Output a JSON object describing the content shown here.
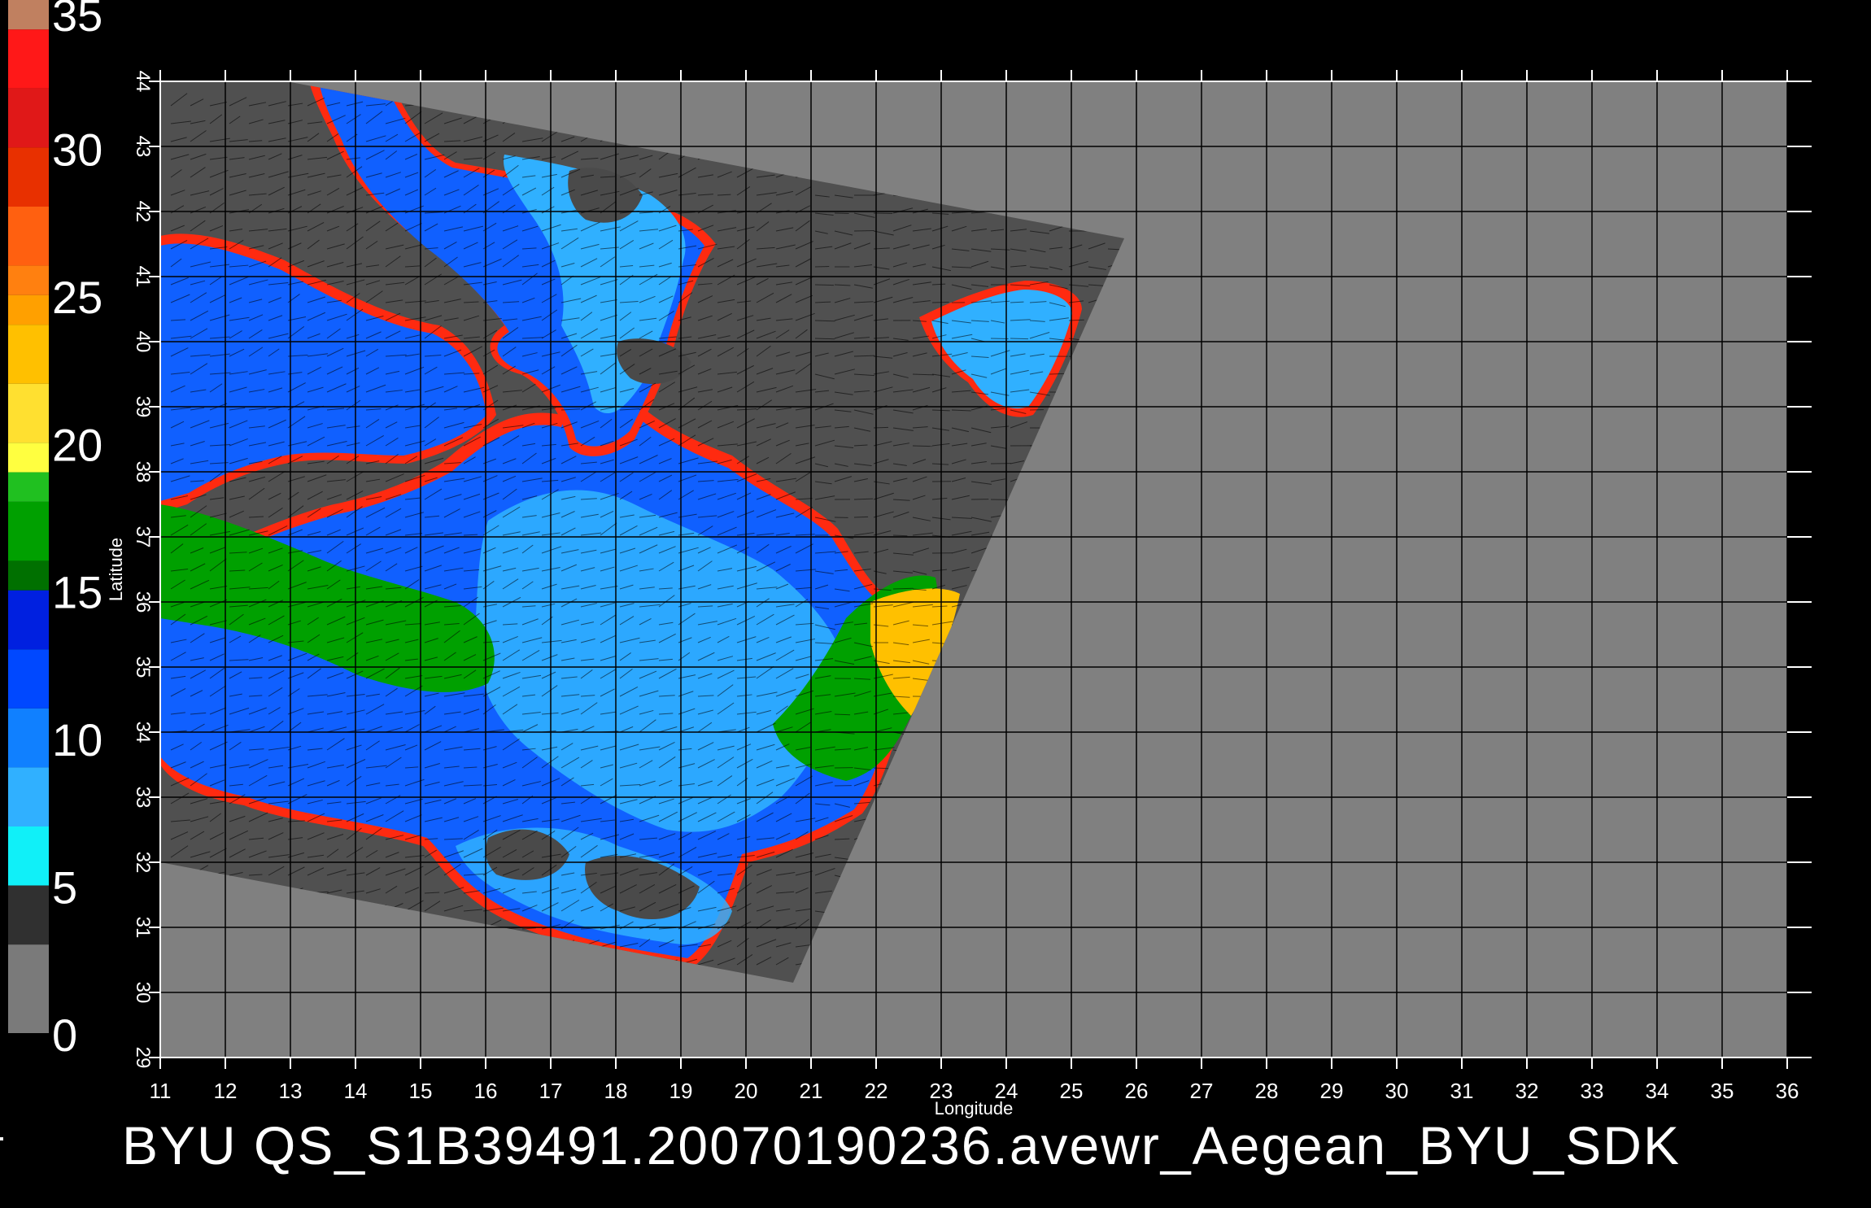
{
  "title": "BYU  QS_S1B39491.20070190236.avewr_Aegean_BYU_SDK",
  "colorbar": {
    "labels": [
      "0",
      "5",
      "10",
      "15",
      "20",
      "25",
      "30",
      "35"
    ],
    "stops": [
      {
        "from": 35,
        "to": 34,
        "color": "#c08060"
      },
      {
        "from": 34,
        "to": 32,
        "color": "#ff1818"
      },
      {
        "from": 32,
        "to": 30,
        "color": "#e01818"
      },
      {
        "from": 30,
        "to": 28,
        "color": "#e83000"
      },
      {
        "from": 28,
        "to": 26,
        "color": "#ff6010"
      },
      {
        "from": 26,
        "to": 25,
        "color": "#ff8010"
      },
      {
        "from": 25,
        "to": 24,
        "color": "#ffa000"
      },
      {
        "from": 24,
        "to": 22,
        "color": "#ffc000"
      },
      {
        "from": 22,
        "to": 20,
        "color": "#ffe030"
      },
      {
        "from": 20,
        "to": 19,
        "color": "#ffff40"
      },
      {
        "from": 19,
        "to": 18,
        "color": "#20c020"
      },
      {
        "from": 18,
        "to": 16,
        "color": "#00a000"
      },
      {
        "from": 16,
        "to": 15,
        "color": "#007000"
      },
      {
        "from": 15,
        "to": 13,
        "color": "#0020e0"
      },
      {
        "from": 13,
        "to": 11,
        "color": "#0048ff"
      },
      {
        "from": 11,
        "to": 9,
        "color": "#1080ff"
      },
      {
        "from": 9,
        "to": 7,
        "color": "#30b0ff"
      },
      {
        "from": 7,
        "to": 5,
        "color": "#10f0f8"
      },
      {
        "from": 5,
        "to": 3,
        "color": "#303030"
      },
      {
        "from": 3,
        "to": 0,
        "color": "#7a7a7a"
      }
    ]
  },
  "map": {
    "x_axis_label": "Longitude",
    "y_axis_label": "Latitude",
    "x_ticks": [
      "11",
      "12",
      "13",
      "14",
      "15",
      "16",
      "17",
      "18",
      "19",
      "20",
      "21",
      "22",
      "23",
      "24",
      "25",
      "26",
      "27",
      "28",
      "29",
      "30",
      "31",
      "32",
      "33",
      "34",
      "35",
      "36"
    ],
    "y_ticks": [
      "29",
      "30",
      "31",
      "32",
      "33",
      "34",
      "35",
      "36",
      "37",
      "38",
      "39",
      "40",
      "41",
      "42",
      "43",
      "44"
    ],
    "lon_range": [
      11,
      36
    ],
    "lat_range": [
      29,
      44
    ],
    "colors": {
      "background": "#000000",
      "no_data": "#808080",
      "swath": "#505050",
      "land_in_swath": "#4a4a4a",
      "grid": "#000000",
      "text": "#ffffff",
      "wind_low": "#30b0ff",
      "wind_mid": "#1060ff",
      "wind_high": "#00a000",
      "wind_vhigh": "#ffc000",
      "coast_fringe": "#ff2020"
    }
  }
}
